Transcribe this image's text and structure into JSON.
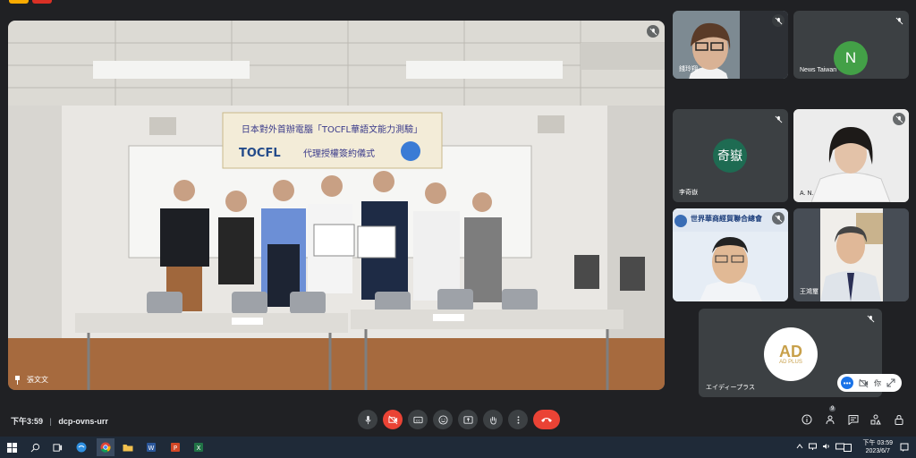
{
  "main_video": {
    "speaker_name": "張文文",
    "banner_line1": "日本對外首辦電腦「TOCFL華語文能力測驗」",
    "banner_line2": "代理授權簽約儀式",
    "banner_logo": "TOCFL"
  },
  "participants": [
    {
      "name": "錢玲翔",
      "type": "video",
      "muted": true
    },
    {
      "name": "News Taiwan",
      "type": "avatar",
      "initial": "N",
      "color": "#43a047",
      "muted": true
    },
    {
      "name": "李奇嶽",
      "type": "avatar",
      "initial": "奇嶽",
      "color": "#1e6b52",
      "muted": true
    },
    {
      "name": "A. N.",
      "type": "video",
      "muted": true
    },
    {
      "name": "世界華商經貿聯合總會",
      "type": "video",
      "muted": true
    },
    {
      "name": "王鴻璽",
      "type": "video",
      "muted": false
    },
    {
      "name": "エイディープラス",
      "type": "avatar",
      "initial": "AD PLUS",
      "muted": true,
      "self_label": "你"
    }
  ],
  "meeting": {
    "time": "下午3:59",
    "code": "dcp-ovns-urr"
  },
  "controls": {
    "icons": [
      "mic-icon",
      "camera-off-icon",
      "captions-icon",
      "emoji-icon",
      "present-icon",
      "raise-hand-icon",
      "more-icon",
      "hangup-icon"
    ],
    "right_icons": [
      "info-icon",
      "people-icon",
      "chat-icon",
      "activities-icon",
      "lock-icon"
    ],
    "people_count": "9"
  },
  "taskbar": {
    "clock_line1": "下午 03:59",
    "clock_line2": "2023/6/7"
  }
}
